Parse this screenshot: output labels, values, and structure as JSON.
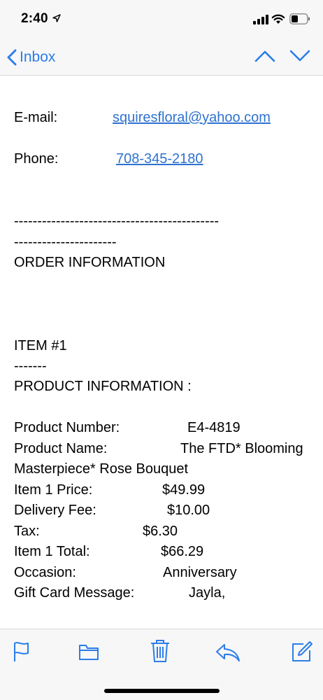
{
  "status_bar": {
    "time": "2:40"
  },
  "nav": {
    "back_label": "Inbox",
    "accent_color": "#2b7de9"
  },
  "contact": {
    "email_label": "E-mail:",
    "email_value": "squiresfloral@yahoo.com",
    "phone_label": "Phone:",
    "phone_value": "708-345-2180"
  },
  "order": {
    "divider_line_1": "--------------------------------------------",
    "divider_line_2": "----------------------",
    "heading": "ORDER INFORMATION",
    "item_heading": "ITEM #1",
    "item_divider": "-------",
    "product_info_heading": "PRODUCT INFORMATION :",
    "fields": {
      "product_number_label": "Product Number:",
      "product_number_value": "E4-4819",
      "product_name_label": "Product Name:",
      "product_name_value_1": "The FTD* Blooming",
      "product_name_value_2": "Masterpiece* Rose Bouquet",
      "item_price_label": "Item 1 Price:",
      "item_price_value": "$49.99",
      "delivery_fee_label": "Delivery Fee:",
      "delivery_fee_value": "$10.00",
      "tax_label": "Tax:",
      "tax_value": "$6.30",
      "item_total_label": "Item 1 Total:",
      "item_total_value": "$66.29",
      "occasion_label": "Occasion:",
      "occasion_value": "Anniversary",
      "gift_message_label": "Gift Card Message:",
      "gift_message_value": "Jayla,"
    }
  },
  "toolbar": {
    "icons": [
      "flag-icon",
      "folder-icon",
      "trash-icon",
      "reply-icon",
      "compose-icon"
    ]
  }
}
